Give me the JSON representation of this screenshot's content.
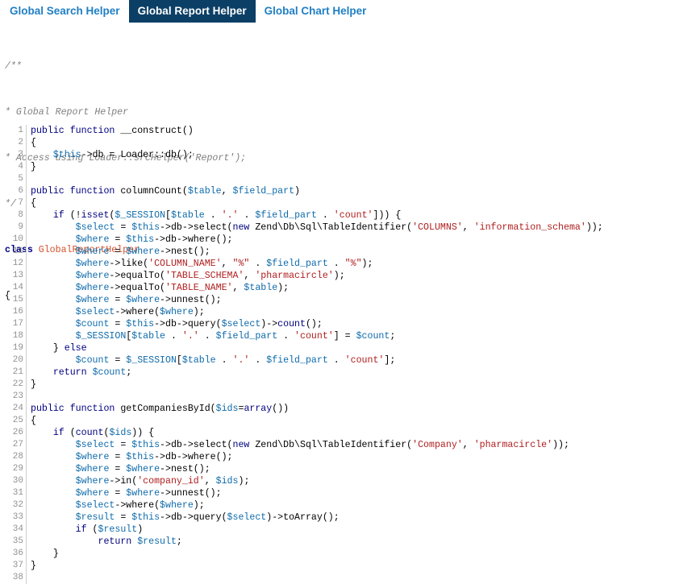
{
  "tabs": [
    {
      "label": "Global Search Helper",
      "active": false
    },
    {
      "label": "Global Report Helper",
      "active": true
    },
    {
      "label": "Global Chart Helper",
      "active": false
    }
  ],
  "header": {
    "comment_lines": [
      "/**",
      "* Global Report Helper",
      "* Access using Loader::srcHelper('Report');",
      "*/"
    ],
    "class_keyword": "class",
    "class_name": "GlobalReportHelper",
    "open_brace": "{"
  },
  "code_lines": [
    {
      "n": "1",
      "text": "public function __construct()"
    },
    {
      "n": "2",
      "text": "{"
    },
    {
      "n": "3",
      "text": "    $this->db = Loader::db();"
    },
    {
      "n": "4",
      "text": "}"
    },
    {
      "n": "5",
      "text": ""
    },
    {
      "n": "6",
      "text": "public function columnCount($table, $field_part)"
    },
    {
      "n": "7",
      "text": "{"
    },
    {
      "n": "8",
      "text": "    if (!isset($_SESSION[$table . '.' . $field_part . 'count'])) {"
    },
    {
      "n": "9",
      "text": "        $select = $this->db->select(new Zend\\Db\\Sql\\TableIdentifier('COLUMNS', 'information_schema'));"
    },
    {
      "n": "10",
      "text": "        $where = $this->db->where();"
    },
    {
      "n": "11",
      "text": "        $where = $where->nest();"
    },
    {
      "n": "12",
      "text": "        $where->like('COLUMN_NAME', \"%\" . $field_part . \"%\");"
    },
    {
      "n": "13",
      "text": "        $where->equalTo('TABLE_SCHEMA', 'pharmacircle');"
    },
    {
      "n": "14",
      "text": "        $where->equalTo('TABLE_NAME', $table);"
    },
    {
      "n": "15",
      "text": "        $where = $where->unnest();"
    },
    {
      "n": "16",
      "text": "        $select->where($where);"
    },
    {
      "n": "17",
      "text": "        $count = $this->db->query($select)->count();"
    },
    {
      "n": "18",
      "text": "        $_SESSION[$table . '.' . $field_part . 'count'] = $count;"
    },
    {
      "n": "19",
      "text": "    } else"
    },
    {
      "n": "20",
      "text": "        $count = $_SESSION[$table . '.' . $field_part . 'count'];"
    },
    {
      "n": "21",
      "text": "    return $count;"
    },
    {
      "n": "22",
      "text": "}"
    },
    {
      "n": "23",
      "text": ""
    },
    {
      "n": "24",
      "text": "public function getCompaniesById($ids=array())"
    },
    {
      "n": "25",
      "text": "{"
    },
    {
      "n": "26",
      "text": "    if (count($ids)) {"
    },
    {
      "n": "27",
      "text": "        $select = $this->db->select(new Zend\\Db\\Sql\\TableIdentifier('Company', 'pharmacircle'));"
    },
    {
      "n": "28",
      "text": "        $where = $this->db->where();"
    },
    {
      "n": "29",
      "text": "        $where = $where->nest();"
    },
    {
      "n": "30",
      "text": "        $where->in('company_id', $ids);"
    },
    {
      "n": "31",
      "text": "        $where = $where->unnest();"
    },
    {
      "n": "32",
      "text": "        $select->where($where);"
    },
    {
      "n": "33",
      "text": "        $result = $this->db->query($select)->toArray();"
    },
    {
      "n": "34",
      "text": "        if ($result)"
    },
    {
      "n": "35",
      "text": "            return $result;"
    },
    {
      "n": "36",
      "text": "    }"
    },
    {
      "n": "37",
      "text": "}"
    },
    {
      "n": "38",
      "text": ""
    }
  ]
}
